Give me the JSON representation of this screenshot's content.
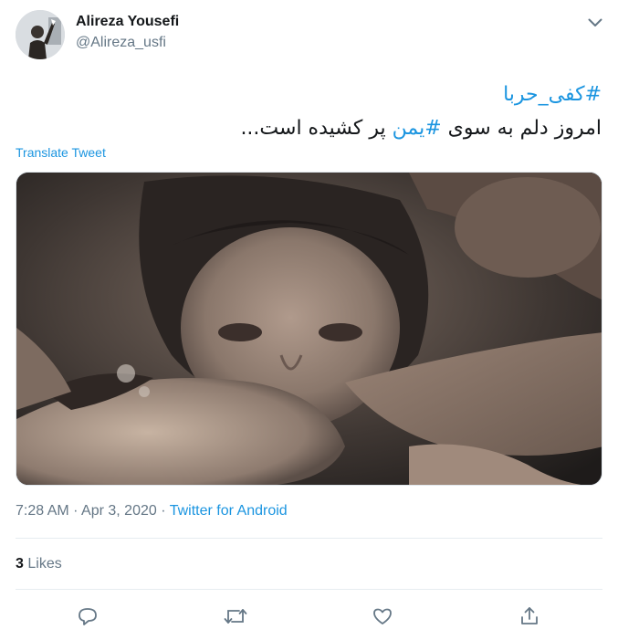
{
  "user": {
    "name": "Alireza Yousefi",
    "handle": "@Alireza_usfi"
  },
  "tweet": {
    "hashtag_line": "#کفی_حربا",
    "text_before": "امروز دلم به سوی ",
    "inline_hashtag": "#یمن",
    "text_after": " پر کشیده است...",
    "translate_label": "Translate Tweet"
  },
  "meta": {
    "time": "7:28 AM",
    "separator": " · ",
    "date": "Apr 3, 2020",
    "source": "Twitter for Android"
  },
  "stats": {
    "likes_count": "3",
    "likes_label": "Likes"
  },
  "actions": {
    "reply": "reply-icon",
    "retweet": "retweet-icon",
    "like": "heart-icon",
    "share": "share-icon"
  },
  "colors": {
    "accent": "#1b95e0",
    "secondary_text": "#657786",
    "primary_text": "#14171a",
    "divider": "#e6ecf0"
  }
}
